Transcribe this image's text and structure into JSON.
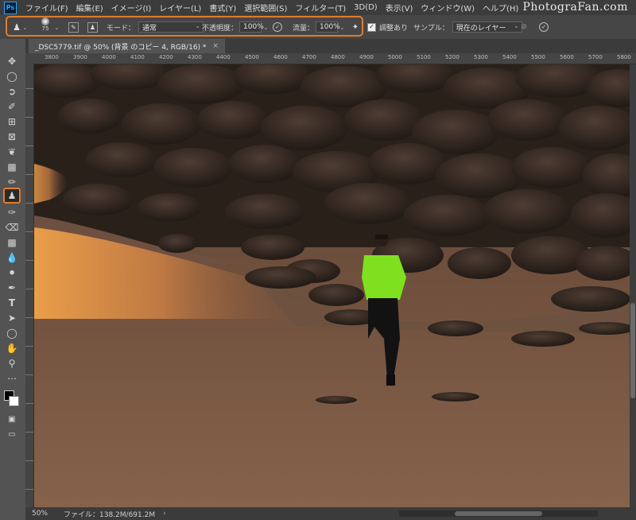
{
  "app": {
    "logo": "Ps",
    "brand": "PhotograFan.com"
  },
  "menu": [
    "ファイル(F)",
    "編集(E)",
    "イメージ(I)",
    "レイヤー(L)",
    "書式(Y)",
    "選択範囲(S)",
    "フィルター(T)",
    "3D(D)",
    "表示(V)",
    "ウィンドウ(W)",
    "ヘルプ(H)"
  ],
  "options": {
    "brush_size": "75",
    "mode_label": "モード：",
    "mode_value": "通常",
    "opacity_label": "不透明度：",
    "opacity_value": "100%",
    "flow_label": "流量：",
    "flow_value": "100%",
    "aligned_label": "調整あり",
    "aligned_checked": true,
    "sample_label": "サンプル：",
    "sample_value": "現在のレイヤー"
  },
  "document": {
    "tab_title": "_DSC5779.tif @ 50% (背景 のコピー 4, RGB/16) *",
    "close": "×"
  },
  "ruler": [
    "3800",
    "3900",
    "4000",
    "4100",
    "4200",
    "4300",
    "4400",
    "4500",
    "4600",
    "4700",
    "4800",
    "4900",
    "5000",
    "5100",
    "5200",
    "5300",
    "5400",
    "5500",
    "5600",
    "5700",
    "5800"
  ],
  "status": {
    "zoom": "50%",
    "file_info": "ファイル：138.2M/691.2M",
    "arrow": "›"
  },
  "tools": [
    "move-tool",
    "marquee-tool",
    "lasso-tool",
    "quick-select-tool",
    "crop-tool",
    "frame-tool",
    "eyedropper-tool",
    "healing-brush-tool",
    "brush-tool",
    "clone-stamp-tool",
    "history-brush-tool",
    "eraser-tool",
    "gradient-tool",
    "blur-tool",
    "dodge-tool",
    "pen-tool",
    "type-tool",
    "path-select-tool",
    "ellipse-tool",
    "hand-tool",
    "zoom-tool",
    "more-tools",
    "color-swatches",
    "quick-mask",
    "screen-mode"
  ],
  "colors": {
    "highlight": "#e07b2a",
    "shirt": "#7ee01f"
  }
}
